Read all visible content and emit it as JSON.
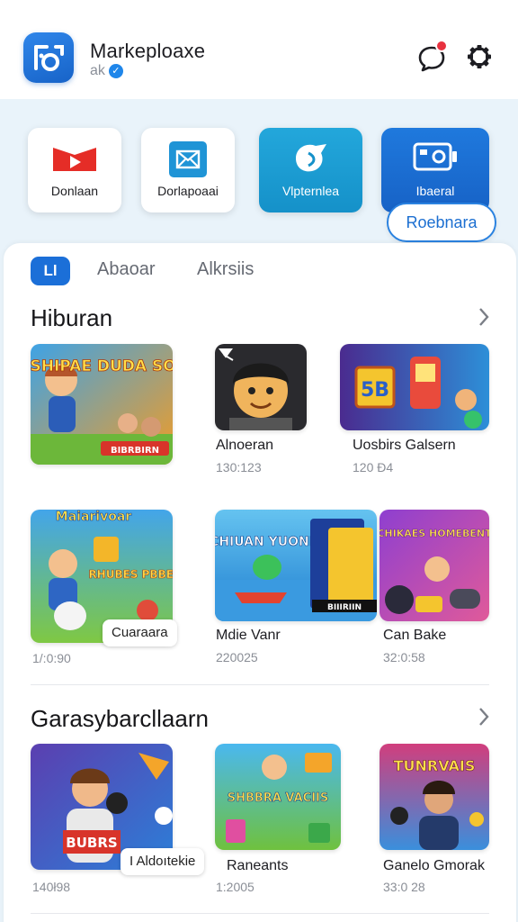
{
  "header": {
    "title": "Markeplоaxe",
    "subtitle": "ak",
    "verified_icon": "check-icon",
    "notification_dot_color": "#e8313f"
  },
  "quick_actions": [
    {
      "label": "Donlaan",
      "icon": "youtube-play-icon"
    },
    {
      "label": "Dorlapoaai",
      "icon": "envelope-icon"
    },
    {
      "label": "Vlpternlea",
      "icon": "megaphone-icon"
    },
    {
      "label": "Ibaeral",
      "icon": "camera-icon"
    }
  ],
  "quick_chip": "Roebnara",
  "tabs": {
    "active": "Ll",
    "items": [
      "Abaoar",
      "Alkrsiis"
    ]
  },
  "sections": [
    {
      "title": "Hiburan",
      "games": [
        {
          "name": "",
          "meta": "",
          "art_text": "SHIPAE DUDA SOINSI!",
          "art_caption": "BIBRBIRN"
        },
        {
          "name": "Alnoeran",
          "meta": "130:123",
          "art_text": "",
          "art_caption": ""
        },
        {
          "name": "Uosbirs Galsern",
          "meta": "120 Đ4",
          "art_text": "5B",
          "art_caption": ""
        },
        {
          "name": "",
          "meta": "1/:0:90",
          "art_text": "Maiarivoar",
          "art_caption": "RHUBES PBBES",
          "badge": "Cuaraara"
        },
        {
          "name": "Mdie Vanr",
          "meta": "220025",
          "art_text": "CHIUAN YUONI",
          "art_caption": "BIIIRIIN"
        },
        {
          "name": "Can Bake",
          "meta": "32:0:58",
          "art_text": "CHIKAES HOMEBENT",
          "art_caption": ""
        }
      ]
    },
    {
      "title": "Garasybarcllaarn",
      "games": [
        {
          "name": "",
          "meta": "140ł98",
          "art_text": "BUBRS",
          "art_caption": "",
          "badge": "I Aldoıtekie"
        },
        {
          "name": "Raneants",
          "meta": "1:2005",
          "art_text": "SHBBRA VACIIS",
          "art_caption": ""
        },
        {
          "name": "Ganelo Gmorak",
          "meta": "33:0 28",
          "art_text": "TUNRVAIS",
          "art_caption": ""
        }
      ]
    }
  ],
  "colors": {
    "accent": "#1b6fd8",
    "background": "#e9f3fa",
    "teal": "#1a9bd2"
  }
}
